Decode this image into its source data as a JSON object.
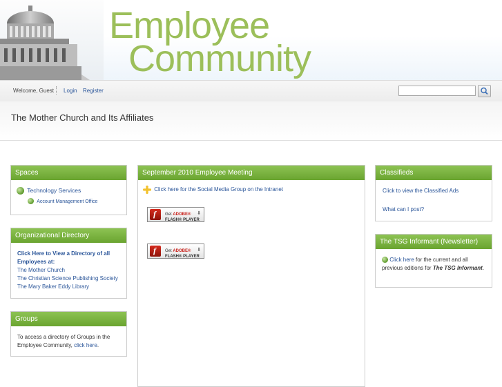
{
  "banner": {
    "title_line1": "Employee",
    "title_line2": "Community"
  },
  "nav": {
    "welcome": "Welcome, Guest",
    "login": "Login",
    "register": "Register",
    "search_placeholder": ""
  },
  "page": {
    "title": "The Mother Church and Its Affiliates"
  },
  "spaces": {
    "title": "Spaces",
    "item": "Technology Services",
    "subitem": "Account Management Office"
  },
  "directory": {
    "title": "Organizational Directory",
    "intro": "Click Here to View a Directory of all Employees at:",
    "links": [
      "The Mother Church",
      "The Christian Science Publishing Society",
      "The Mary Baker Eddy Library"
    ]
  },
  "groups": {
    "title": "Groups",
    "text": "To access a directory of Groups in the Employee Community, ",
    "link": "click here",
    "end": "."
  },
  "meeting": {
    "title": "September 2010 Employee Meeting",
    "link": "Click here for the Social Media Group on the Intranet",
    "flash": {
      "line1_a": "Get ",
      "line1_b": "ADOBE®",
      "line2": "FLASH® PLAYER"
    }
  },
  "classifieds": {
    "title": "Classifieds",
    "link1": "Click to view the Classified Ads",
    "link2": "What can I post?"
  },
  "newsletter": {
    "title": "The TSG Informant (Newsletter)",
    "link": "Click here",
    "text": " for the current and all previous editions for ",
    "em": "The TSG Informant",
    "end": "."
  }
}
